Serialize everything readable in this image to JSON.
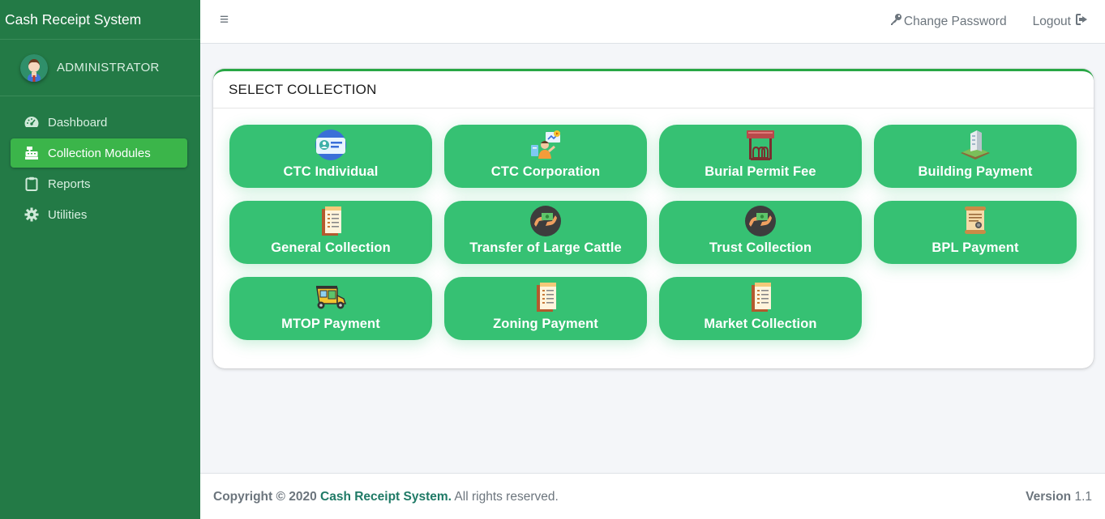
{
  "app": {
    "title": "Cash Receipt System"
  },
  "user": {
    "name": "ADMINISTRATOR"
  },
  "sidebar": {
    "items": [
      {
        "label": "Dashboard",
        "icon": "tachometer-icon"
      },
      {
        "label": "Collection Modules",
        "icon": "cash-register-icon",
        "active": true
      },
      {
        "label": "Reports",
        "icon": "clipboard-icon"
      },
      {
        "label": "Utilities",
        "icon": "gear-icon"
      }
    ]
  },
  "topbar": {
    "menu_icon": "≡",
    "change_password": "Change Password",
    "logout": "Logout"
  },
  "card": {
    "title": "SELECT COLLECTION",
    "modules": [
      {
        "label": "CTC Individual",
        "icon": "id-card-icon"
      },
      {
        "label": "CTC Corporation",
        "icon": "corporate-presenter-icon"
      },
      {
        "label": "Burial Permit Fee",
        "icon": "cemetery-icon"
      },
      {
        "label": "Building Payment",
        "icon": "building-icon"
      },
      {
        "label": "General Collection",
        "icon": "receipt-icon"
      },
      {
        "label": "Transfer of Large Cattle",
        "icon": "money-exchange-icon"
      },
      {
        "label": "Trust Collection",
        "icon": "money-exchange-icon"
      },
      {
        "label": "BPL Payment",
        "icon": "scroll-document-icon"
      },
      {
        "label": "MTOP Payment",
        "icon": "tricycle-icon"
      },
      {
        "label": "Zoning Payment",
        "icon": "receipt-icon"
      },
      {
        "label": "Market Collection",
        "icon": "receipt-icon"
      }
    ]
  },
  "footer": {
    "copyright_prefix": "Copyright © 2020 ",
    "brand": "Cash Receipt System.",
    "rights": " All rights reserved.",
    "version_label": "Version",
    "version_value": " 1.1"
  },
  "colors": {
    "sidebar": "#237a46",
    "active_nav": "#3bb54a",
    "tile": "#36c173",
    "card_accent": "#28a745"
  }
}
